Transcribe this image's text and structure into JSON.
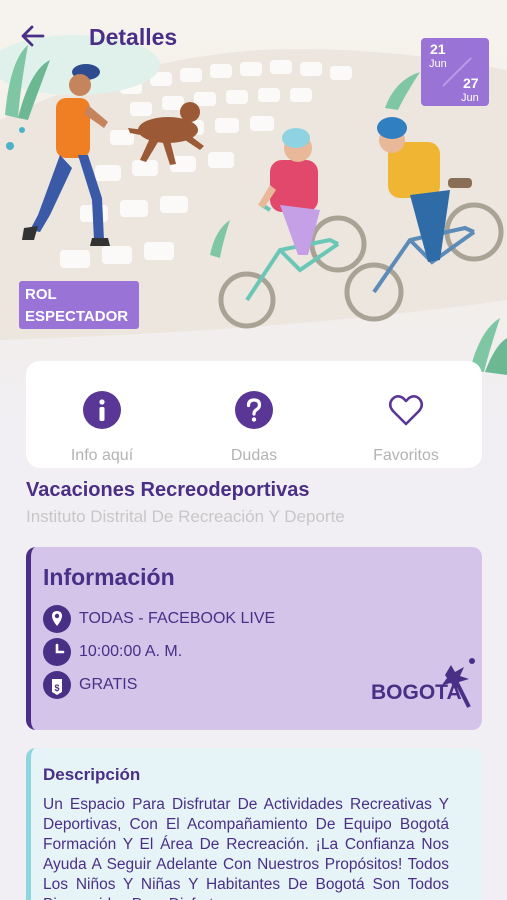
{
  "header": {
    "title": "Detalles",
    "back_icon": "arrow-left-icon"
  },
  "dates": {
    "start_day": "21",
    "start_month": "Jun",
    "end_day": "27",
    "end_month": "Jun"
  },
  "role_badge": {
    "line1": "ROL",
    "line2": "ESPECTADOR"
  },
  "actions": [
    {
      "label": "Info aquí",
      "icon": "info-icon"
    },
    {
      "label": "Dudas",
      "icon": "question-icon"
    },
    {
      "label": "Favoritos",
      "icon": "heart-icon"
    }
  ],
  "event": {
    "title": "Vacaciones Recreodeportivas",
    "organizer": "Instituto Distrital De Recreación Y Deporte"
  },
  "info": {
    "heading": "Información",
    "location": "TODAS - FACEBOOK LIVE",
    "time": "10:00:00 A. M.",
    "price": "GRATIS",
    "logo_text": "BOGOTA"
  },
  "description": {
    "heading": "Descripción",
    "text": "Un Espacio Para Disfrutar De Actividades Recreativas Y Deportivas, Con El Acompañamiento De Equipo Bogotá Formación Y El Área De Recreación. ¡La Confianza Nos Ayuda A Seguir Adelante Con Nuestros Propósitos! Todos Los Niños Y Niñas Y Habitantes De Bogotá Son Todos Bienvenidos Para Disfrutar"
  },
  "colors": {
    "primary": "#4a2f86",
    "accent": "#9a73d6",
    "info_bg": "#d4c4e9",
    "desc_bg": "#e6f4f7"
  }
}
